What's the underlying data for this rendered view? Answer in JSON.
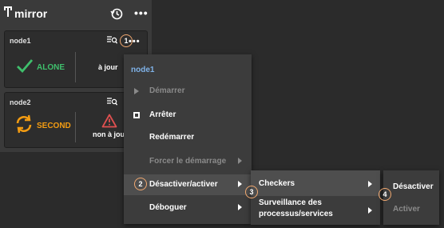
{
  "panel": {
    "title": "mirror",
    "more": "•••",
    "icons": {
      "cluster": "cluster-icon",
      "history": "history-icon"
    }
  },
  "nodes": [
    {
      "name": "node1",
      "state": "ALONE",
      "sync": "à jour",
      "state_color": "#3fbf6c",
      "state_icon": "check-icon"
    },
    {
      "name": "node2",
      "state": "SECOND",
      "sync": "non à jour",
      "state_color": "#f39c12",
      "state_icon": "sync-icon",
      "sync_icon": "warning-icon"
    }
  ],
  "node_more": "•••",
  "steps": [
    "1",
    "2",
    "3",
    "4"
  ],
  "context_menu": {
    "title": "node1",
    "items": [
      {
        "label": "Démarrer",
        "disabled": true,
        "icon": "play-icon"
      },
      {
        "label": "Arrêter",
        "disabled": false,
        "icon": "stop-icon"
      },
      {
        "label": "Redémarrer",
        "disabled": false
      },
      {
        "label": "Forcer le démarrage",
        "disabled": true,
        "submenu": true
      },
      {
        "label": "Désactiver/activer",
        "disabled": false,
        "submenu": true,
        "highlighted": true
      },
      {
        "label": "Déboguer",
        "disabled": false,
        "submenu": true
      }
    ]
  },
  "submenu": {
    "items": [
      {
        "label": "Checkers",
        "highlighted": true
      },
      {
        "label_line1": "Surveillance des",
        "label_line2": "processus/services"
      }
    ]
  },
  "subsubmenu": {
    "items": [
      {
        "label": "Désactiver",
        "disabled": false
      },
      {
        "label": "Activer",
        "disabled": true
      }
    ]
  },
  "colors": {
    "accent_blue": "#7fb2e8",
    "ok_green": "#3fbf6c",
    "warn_orange": "#f39c12",
    "error_red": "#e05050",
    "badge_orange": "#f0a870"
  }
}
